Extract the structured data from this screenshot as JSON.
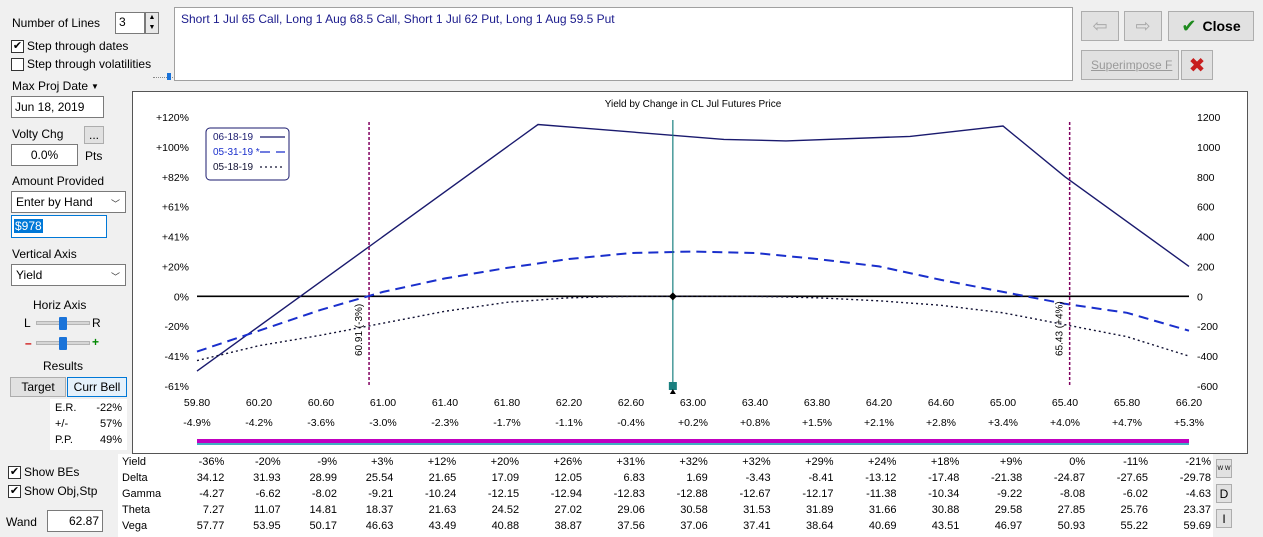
{
  "controls": {
    "number_of_lines_label": "Number of Lines",
    "number_of_lines_value": "3",
    "step_dates_label": "Step through dates",
    "step_dates_checked": true,
    "step_vols_label": "Step through volatilities",
    "step_vols_checked": false,
    "max_proj_date_label": "Max Proj Date",
    "max_proj_date_value": "Jun 18, 2019",
    "volty_chg_label": "Volty Chg",
    "volty_btn_label": "...",
    "volty_value": "0.0%",
    "volty_unit": "Pts",
    "amount_provided_label": "Amount Provided",
    "amount_mode": "Enter by Hand",
    "amount_value": "$978",
    "vertical_axis_label": "Vertical Axis",
    "vertical_axis_value": "Yield",
    "horiz_axis_label": "Horiz Axis",
    "horiz_left": "L",
    "horiz_right": "R",
    "zoom_minus": "–",
    "zoom_plus": "+",
    "results_label": "Results",
    "target_label": "Target",
    "curr_bell_label": "Curr Bell",
    "results": [
      {
        "label": "E.R.",
        "value": "-22%"
      },
      {
        "label": "+/-",
        "value": "57%"
      },
      {
        "label": "P.P.",
        "value": "49%"
      }
    ],
    "show_bes_label": "Show BEs",
    "show_bes_checked": true,
    "show_obj_label": "Show Obj,Stp",
    "show_obj_checked": true,
    "wand_label": "Wand",
    "wand_value": "62.87"
  },
  "description": "Short 1 Jul 65 Call, Long 1 Aug 68.5 Call, Short 1 Jul 62 Put, Long 1 Aug 59.5 Put",
  "toolbar": {
    "back_icon": "arrow-left-icon",
    "forward_icon": "arrow-right-icon",
    "close_label": "Close",
    "superimpose_label": "Superimpose F",
    "delete_icon": "red-x-icon"
  },
  "chart_data": {
    "type": "line",
    "title": "Yield by Change in CL Jul Futures Price",
    "x_ticks": [
      "59.80",
      "60.20",
      "60.60",
      "61.00",
      "61.40",
      "61.80",
      "62.20",
      "62.60",
      "63.00",
      "63.40",
      "63.80",
      "64.20",
      "64.60",
      "65.00",
      "65.40",
      "65.80",
      "66.20"
    ],
    "x_pct_ticks": [
      "-4.9%",
      "-4.2%",
      "-3.6%",
      "-3.0%",
      "-2.3%",
      "-1.7%",
      "-1.1%",
      "-0.4%",
      "+0.2%",
      "+0.8%",
      "+1.5%",
      "+2.1%",
      "+2.8%",
      "+3.4%",
      "+4.0%",
      "+4.7%",
      "+5.3%"
    ],
    "y_left_ticks": [
      "+120%",
      "+100%",
      "+82%",
      "+61%",
      "+41%",
      "+20%",
      "0%",
      "-20%",
      "-41%",
      "-61%"
    ],
    "y_right_ticks": [
      "1200",
      "1000",
      "800",
      "600",
      "400",
      "200",
      "0",
      "-200",
      "-400",
      "-600"
    ],
    "xlim": [
      59.8,
      66.2
    ],
    "ylim": [
      -600,
      1200
    ],
    "legend": [
      "06-18-19",
      "05-31-19 *",
      "05-18-19"
    ],
    "legend_position": "top-left",
    "breakevens": [
      {
        "x": 60.91,
        "label": "60.91 (-3%)"
      },
      {
        "x": 65.43,
        "label": "65.43 (+4%)"
      }
    ],
    "current_x": 62.87,
    "series": [
      {
        "name": "06-18-19",
        "color": "#1a1a6e",
        "dash": "solid",
        "x": [
          59.8,
          62.0,
          63.2,
          63.6,
          64.4,
          65.0,
          65.4,
          66.2
        ],
        "y": [
          -500,
          1150,
          1050,
          1040,
          1070,
          1140,
          800,
          200
        ]
      },
      {
        "name": "05-31-19 *",
        "color": "#1a2fcc",
        "dash": "long",
        "x": [
          59.8,
          60.2,
          60.6,
          61.0,
          61.4,
          61.8,
          62.2,
          62.6,
          63.0,
          63.4,
          63.8,
          64.2,
          64.6,
          65.0,
          65.4,
          65.8,
          66.2
        ],
        "y": [
          -370,
          -230,
          -90,
          30,
          120,
          190,
          250,
          290,
          300,
          290,
          250,
          200,
          110,
          30,
          -50,
          -110,
          -230
        ]
      },
      {
        "name": "05-18-19",
        "color": "#111133",
        "dash": "dot",
        "x": [
          59.8,
          60.2,
          60.6,
          61.0,
          61.4,
          61.8,
          62.2,
          62.6,
          63.0,
          63.4,
          63.8,
          64.2,
          64.6,
          65.0,
          65.4,
          65.8,
          66.2
        ],
        "y": [
          -430,
          -330,
          -260,
          -180,
          -100,
          -40,
          -10,
          0,
          0,
          0,
          -10,
          -30,
          -60,
          -110,
          -190,
          -270,
          -400
        ]
      }
    ]
  },
  "stats": {
    "rows": [
      {
        "label": "Yield",
        "values": [
          "-36%",
          "-20%",
          "-9%",
          "+3%",
          "+12%",
          "+20%",
          "+26%",
          "+31%",
          "+32%",
          "+32%",
          "+29%",
          "+24%",
          "+18%",
          "+9%",
          "0%",
          "-11%",
          "-21%"
        ]
      },
      {
        "label": "Delta",
        "values": [
          "34.12",
          "31.93",
          "28.99",
          "25.54",
          "21.65",
          "17.09",
          "12.05",
          "6.83",
          "1.69",
          "-3.43",
          "-8.41",
          "-13.12",
          "-17.48",
          "-21.38",
          "-24.87",
          "-27.65",
          "-29.78"
        ]
      },
      {
        "label": "Gamma",
        "values": [
          "-4.27",
          "-6.62",
          "-8.02",
          "-9.21",
          "-10.24",
          "-12.15",
          "-12.94",
          "-12.83",
          "-12.88",
          "-12.67",
          "-12.17",
          "-11.38",
          "-10.34",
          "-9.22",
          "-8.08",
          "-6.02",
          "-4.63"
        ]
      },
      {
        "label": "Theta",
        "values": [
          "7.27",
          "11.07",
          "14.81",
          "18.37",
          "21.63",
          "24.52",
          "27.02",
          "29.06",
          "30.58",
          "31.53",
          "31.89",
          "31.66",
          "30.88",
          "29.58",
          "27.85",
          "25.76",
          "23.37"
        ]
      },
      {
        "label": "Vega",
        "values": [
          "57.77",
          "53.95",
          "50.17",
          "46.63",
          "43.49",
          "40.88",
          "38.87",
          "37.56",
          "37.06",
          "37.41",
          "38.64",
          "40.69",
          "43.51",
          "46.97",
          "50.93",
          "55.22",
          "59.69"
        ]
      }
    ]
  },
  "side_buttons": {
    "w_label": "W W",
    "d_label": "D",
    "i_label": "I"
  }
}
